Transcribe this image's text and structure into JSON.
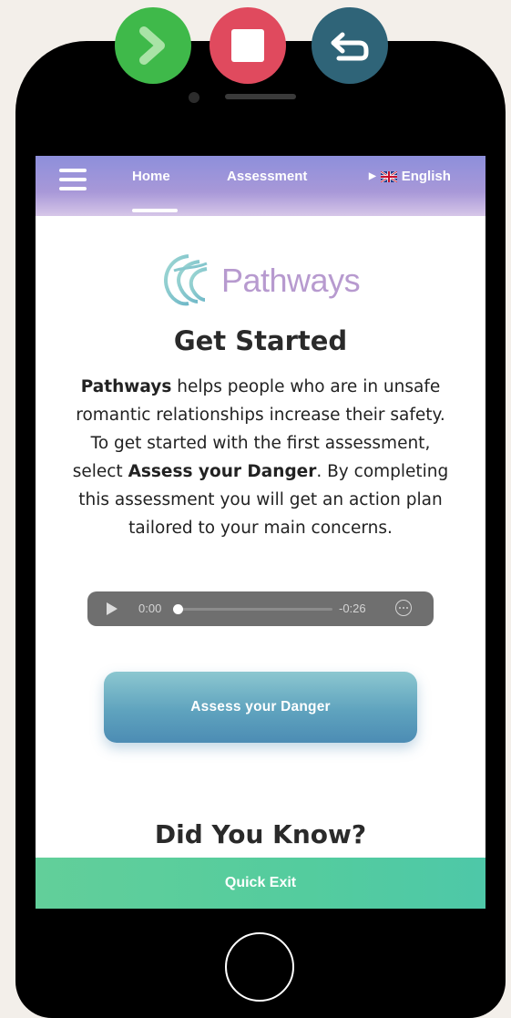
{
  "controls": {
    "next_color": "#3fb94a",
    "stop_color": "#e04a5e",
    "back_color": "#2f6478"
  },
  "nav": {
    "home_label": "Home",
    "assessment_label": "Assessment",
    "language_label": "English",
    "language_icon": "uk-flag-icon"
  },
  "brand": {
    "logo_text": "Pathways",
    "logo_color": "#b79acf"
  },
  "main": {
    "title": "Get Started",
    "intro_bold_1": "Pathways",
    "intro_text_1": " helps people who are in unsafe romantic relationships increase their safety. To get started with the first assessment, select ",
    "intro_bold_2": "Assess your Danger",
    "intro_text_2": ". By completing this assessment you will get an action plan tailored to your main concerns.",
    "assess_button": "Assess your Danger",
    "did_you_know": "Did You Know?"
  },
  "audio": {
    "current_time": "0:00",
    "remaining_time": "-0:26",
    "progress": 0
  },
  "footer": {
    "quick_exit": "Quick Exit"
  }
}
